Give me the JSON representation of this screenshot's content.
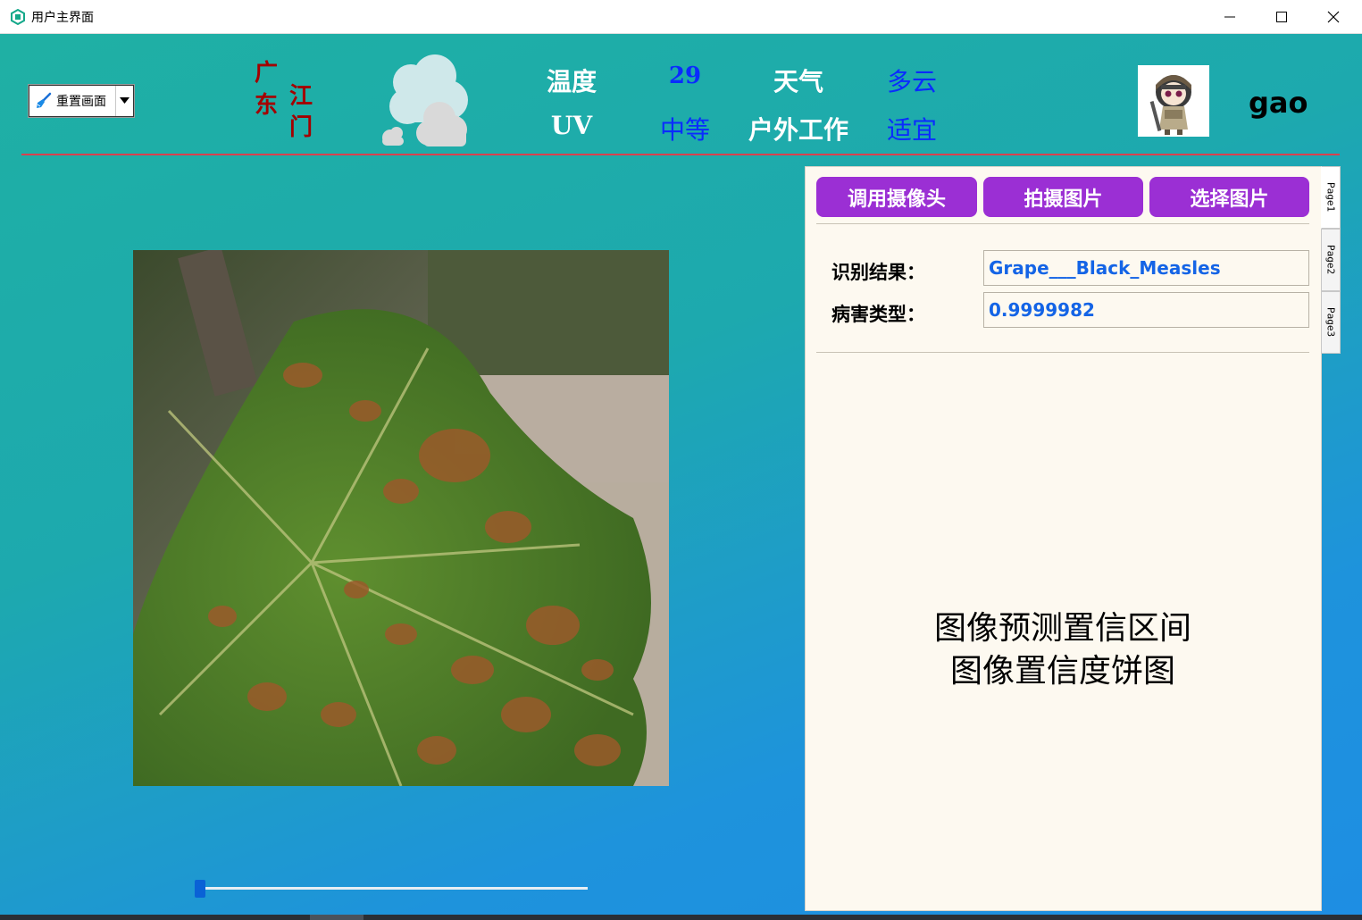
{
  "window": {
    "title": "用户主界面",
    "controls": [
      "minimize",
      "maximize",
      "close"
    ]
  },
  "header": {
    "reset_select": {
      "selected": "重置画面",
      "icon": "broom-icon"
    },
    "location": {
      "province_1": "广",
      "province_2": "东",
      "city_1": "江",
      "city_2": "门"
    },
    "weather_icon": "cloud-icon",
    "weather": {
      "temp_label": "温度",
      "temp_value": "29",
      "weather_label": "天气",
      "weather_value": "多云",
      "uv_label": "UV",
      "uv_value": "中等",
      "outdoor_label": "户外工作",
      "outdoor_value": "适宜"
    },
    "user": {
      "avatar": "avatar-image",
      "name": "gao"
    }
  },
  "colors": {
    "accent_purple": "#9b2fd4",
    "divider_red": "#d9414e",
    "value_blue": "#0a2bff",
    "result_blue": "#1464e6",
    "location_red": "#a30000"
  },
  "image_panel": {
    "slider_value": 0
  },
  "right_panel": {
    "buttons": {
      "camera": "调用摄像头",
      "capture": "拍摄图片",
      "select": "选择图片"
    },
    "result_label": "识别结果：",
    "result_value": "Grape___Black_Measles",
    "type_label": "病害类型：",
    "type_value": "0.9999982",
    "chart_placeholder_line1": "图像预测置信区间",
    "chart_placeholder_line2": "图像置信度饼图"
  },
  "tabs": [
    "Page1",
    "Page2",
    "Page3"
  ]
}
